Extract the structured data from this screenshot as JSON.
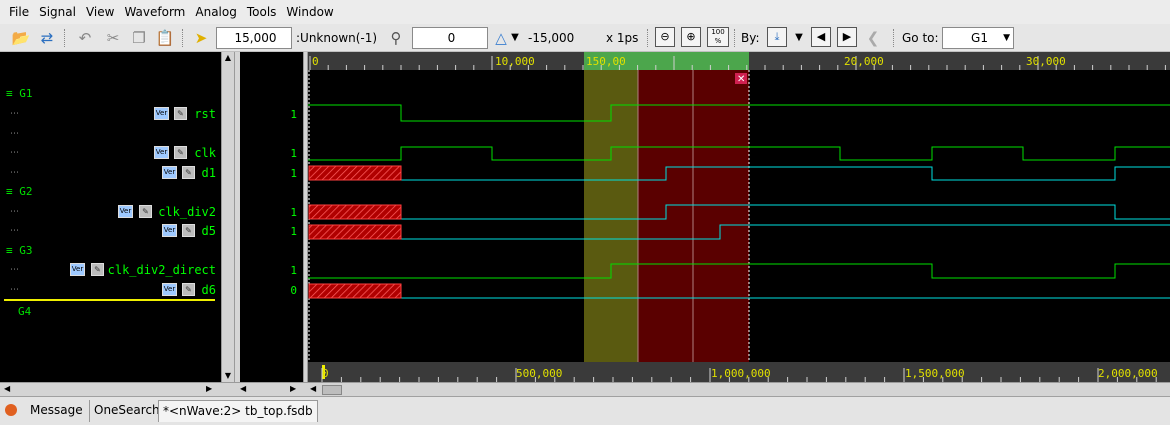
{
  "menu": [
    "File",
    "Signal",
    "View",
    "Waveform",
    "Analog",
    "Tools",
    "Window"
  ],
  "toolbar": {
    "cursor_time": "15,000",
    "unknown_label": ":Unknown(-1)",
    "marker_value": "0",
    "delta_value": "-15,000",
    "time_unit": "x 1ps",
    "zoom_pct": "100 %",
    "by_label": "By:",
    "goto_label": "Go to:",
    "goto_value": "G1"
  },
  "groups": [
    {
      "name": "G1"
    },
    {
      "name": "G2"
    },
    {
      "name": "G3"
    },
    {
      "name": "G4"
    }
  ],
  "signals": [
    {
      "name": "rst",
      "value": "1"
    },
    {
      "name": "clk",
      "value": "1"
    },
    {
      "name": "d1",
      "value": "1"
    },
    {
      "name": "clk_div2",
      "value": "1"
    },
    {
      "name": "d5",
      "value": "1"
    },
    {
      "name": "clk_div2_direct",
      "value": "1"
    },
    {
      "name": "d6",
      "value": "0"
    }
  ],
  "badges": {
    "ver": "Ver",
    "edit": "✎"
  },
  "ruler_top": [
    "0",
    "10,000",
    "150,00",
    "20,000",
    "30,000"
  ],
  "ruler_bottom": [
    "0",
    "500,000",
    "1,000,000",
    "1,500,000",
    "2,000,000"
  ],
  "tabs": {
    "message": "Message",
    "onesearch": "OneSearch",
    "nwave": "*<nWave:2> tb_top.fsdb"
  },
  "colors": {
    "wave_high": "#00e000",
    "wave_low": "#00c0e0",
    "unknown_fill": "#c00000",
    "region_yellow": "#5a5a10",
    "region_red": "#5a0000",
    "accent_bar": "#f0f000"
  }
}
